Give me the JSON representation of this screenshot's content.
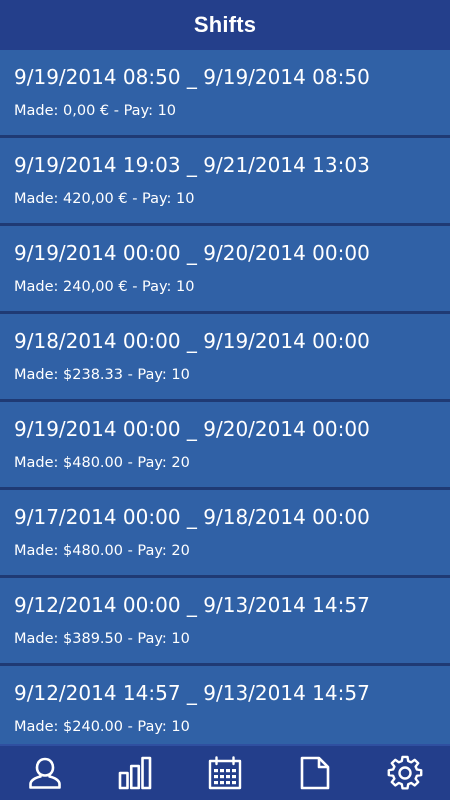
{
  "header": {
    "title": "Shifts"
  },
  "shifts": [
    {
      "dates": "9/19/2014 08:50 _ 9/19/2014 08:50",
      "meta": "Made: 0,00 € - Pay: 10"
    },
    {
      "dates": "9/19/2014 19:03 _ 9/21/2014 13:03",
      "meta": "Made: 420,00 € - Pay: 10"
    },
    {
      "dates": "9/19/2014 00:00 _ 9/20/2014 00:00",
      "meta": "Made: 240,00 € - Pay: 10"
    },
    {
      "dates": "9/18/2014 00:00 _ 9/19/2014 00:00",
      "meta": "Made: $238.33 - Pay: 10"
    },
    {
      "dates": "9/19/2014 00:00 _ 9/20/2014 00:00",
      "meta": "Made: $480.00 - Pay: 20"
    },
    {
      "dates": "9/17/2014 00:00 _ 9/18/2014 00:00",
      "meta": "Made: $480.00 - Pay: 20"
    },
    {
      "dates": "9/12/2014 00:00 _ 9/13/2014 14:57",
      "meta": "Made: $389.50 - Pay: 10"
    },
    {
      "dates": "9/12/2014 14:57 _ 9/13/2014 14:57",
      "meta": "Made: $240.00 - Pay: 10"
    }
  ],
  "tabbar": {
    "tabs": [
      {
        "icon": "person-icon"
      },
      {
        "icon": "bar-chart-icon"
      },
      {
        "icon": "calendar-icon"
      },
      {
        "icon": "document-icon"
      },
      {
        "icon": "gear-icon"
      }
    ]
  },
  "colors": {
    "header_bg": "#243f8b",
    "row_bg": "#3061a6",
    "row_divider": "#1f3a74",
    "tabbar_bg": "#233e8b",
    "text": "#ffffff"
  }
}
